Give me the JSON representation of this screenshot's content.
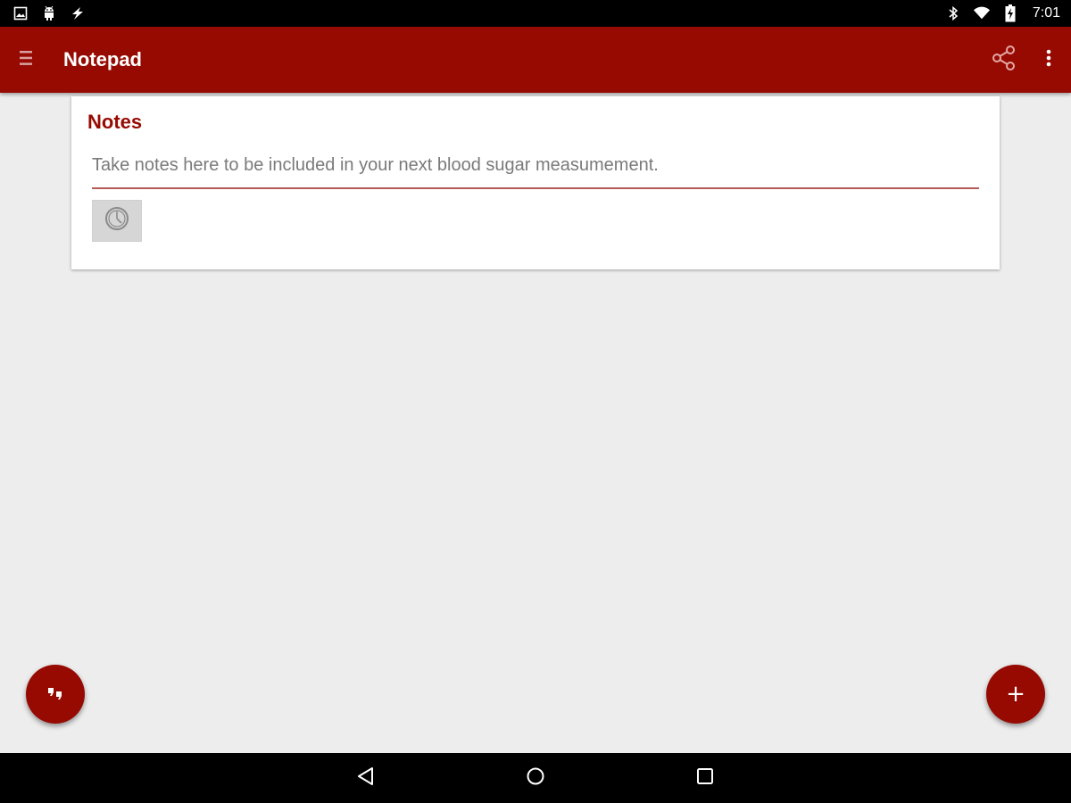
{
  "status_bar": {
    "time": "7:01",
    "left_icons": [
      "image-icon",
      "android-icon",
      "flash-icon"
    ],
    "right_icons": [
      "bluetooth-icon",
      "wifi-icon",
      "battery-charging-icon"
    ]
  },
  "app_bar": {
    "title": "Notepad",
    "menu_icon": "hamburger-menu-icon",
    "actions": [
      "share-icon",
      "more-vert-icon"
    ]
  },
  "card": {
    "title": "Notes",
    "input": {
      "value": "",
      "placeholder": "Take notes here to be included in your next blood sugar measumement."
    },
    "timestamp_button_icon": "clock-icon"
  },
  "fabs": {
    "left_icon": "quote-icon",
    "right_label": "+"
  },
  "nav_bar": {
    "buttons": [
      "back-icon",
      "home-icon",
      "recents-icon"
    ]
  },
  "colors": {
    "primary": "#960a02",
    "background": "#ededed",
    "input_underline": "#b55a57"
  }
}
